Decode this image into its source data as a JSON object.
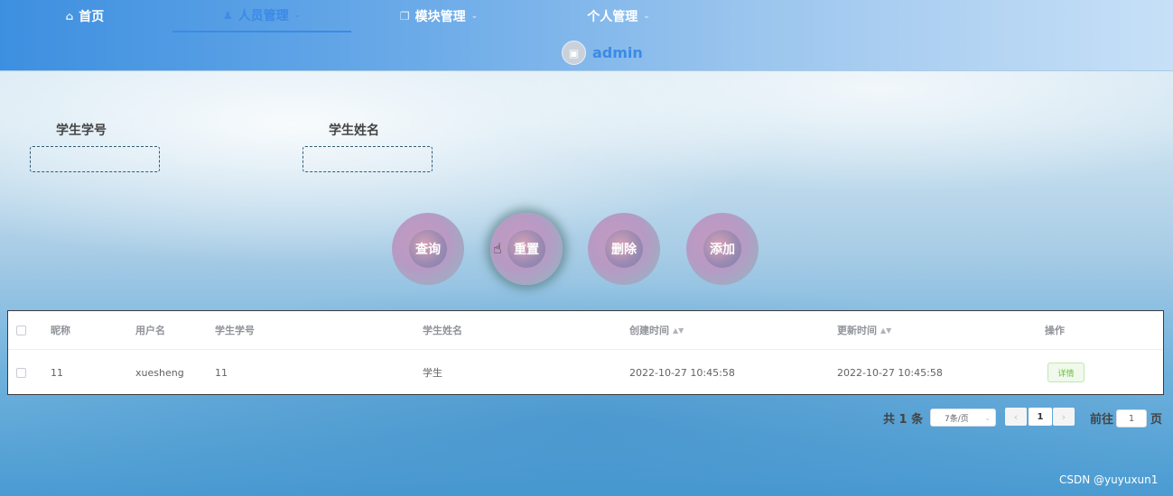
{
  "nav": {
    "items": [
      {
        "label": "首页",
        "icon": "home-icon",
        "active": false,
        "dropdown": false
      },
      {
        "label": "人员管理",
        "icon": "user-icon",
        "active": true,
        "dropdown": true
      },
      {
        "label": "模块管理",
        "icon": "module-icon",
        "active": false,
        "dropdown": true
      },
      {
        "label": "个人管理",
        "icon": "",
        "active": false,
        "dropdown": true
      }
    ],
    "user": {
      "name": "admin",
      "avatar_icon": "image-icon"
    },
    "accent_color": "#3b8ae6"
  },
  "search": {
    "student_id_label": "学生学号",
    "student_id_value": "",
    "student_name_label": "学生姓名",
    "student_name_value": ""
  },
  "actions": {
    "query": "查询",
    "reset": "重置",
    "delete": "删除",
    "add": "添加"
  },
  "table": {
    "columns": {
      "nickname": "昵称",
      "username": "用户名",
      "student_id": "学生学号",
      "student_name": "学生姓名",
      "created": "创建时间",
      "updated": "更新时间",
      "ops": "操作"
    },
    "rows": [
      {
        "nickname": "11",
        "username": "xuesheng",
        "student_id": "11",
        "student_name": "学生",
        "created": "2022-10-27 10:45:58",
        "updated": "2022-10-27 10:45:58",
        "detail": "详情"
      }
    ]
  },
  "pagination": {
    "total": "共 1 条",
    "page_size": "7条/页",
    "current_page": "1",
    "goto_label": "前往",
    "goto_value": "1",
    "page_unit": "页"
  },
  "watermark": "CSDN @yuyuxun1"
}
